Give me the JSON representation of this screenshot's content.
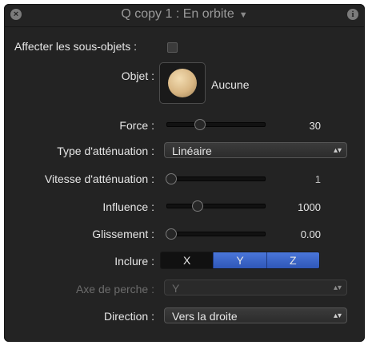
{
  "window": {
    "close_icon": "close-icon",
    "title": "Q copy 1 : En orbite",
    "title_caret": "▼",
    "info_icon": "info-icon"
  },
  "affect_subobjects": {
    "label": "Affecter les sous-objets :",
    "checked": false
  },
  "object": {
    "label": "Objet :",
    "value": "Aucune"
  },
  "force": {
    "label": "Force :",
    "value": "30",
    "fraction": 0.33
  },
  "falloff_type": {
    "label": "Type d'atténuation :",
    "selected": "Linéaire"
  },
  "falloff_rate": {
    "label": "Vitesse d'atténuation :",
    "value": "1",
    "fraction": 0.0
  },
  "influence": {
    "label": "Influence :",
    "value": "1000",
    "fraction": 0.3
  },
  "drag": {
    "label": "Glissement :",
    "value": "0.00",
    "fraction": 0.0
  },
  "include": {
    "label": "Inclure :",
    "options": [
      "X",
      "Y",
      "Z"
    ],
    "selected": [
      "Y",
      "Z"
    ]
  },
  "pole_axis": {
    "label": "Axe de perche :",
    "selected": "Y",
    "enabled": false
  },
  "direction": {
    "label": "Direction :",
    "selected": "Vers la droite"
  },
  "colors": {
    "accent": "#3a65c9",
    "panel": "#232323"
  }
}
